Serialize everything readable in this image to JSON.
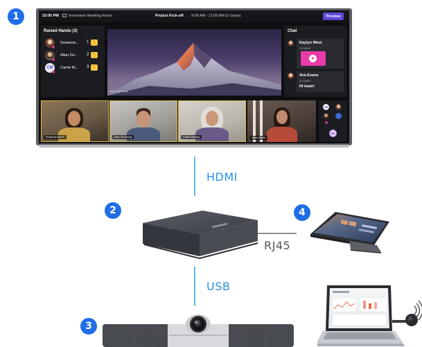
{
  "badges": {
    "display": "1",
    "hub": "2",
    "camera": "3",
    "touch_panel": "4"
  },
  "meeting": {
    "time": "10:00 PM",
    "room": "Immersive Meeting Room",
    "title": "Project Kick-off",
    "time_range": "9:00 AM - 11:00 AM (2 hours)",
    "preview_label": "Preview"
  },
  "raised_hands": {
    "title": "Raised Hands (3)",
    "people": [
      {
        "name": "Susanna...",
        "rank": "1",
        "initials": ""
      },
      {
        "name": "Allan De...",
        "rank": "2",
        "initials": ""
      },
      {
        "name": "Carrie M...",
        "rank": "3",
        "initials": "CM"
      }
    ]
  },
  "stage": {
    "speaker": "Allan DeYoung"
  },
  "chat": {
    "title": "Chat",
    "messages": [
      {
        "author": "Kaylyn West",
        "time": "10:08AM",
        "text": ""
      },
      {
        "author": "Ava Evans",
        "time": "10:08AM",
        "text": "Hi team!"
      }
    ]
  },
  "tiles": [
    {
      "caption": "Susanna Alberti"
    },
    {
      "caption": "Allan DeYoung"
    },
    {
      "caption": "Carrie Murphy"
    },
    {
      "caption": "Jena Glante"
    }
  ],
  "roster_initials": [
    "CM",
    "MK"
  ],
  "connections": {
    "hdmi": "HDMI",
    "rj45": "RJ45",
    "usb": "USB"
  },
  "colors": {
    "accent_blue": "#1f6ee8",
    "line_blue": "#5ab8e8",
    "connector_text_blue": "#2a8fe0",
    "rj45_text": "#555555",
    "preview_purple": "#5b4bd6"
  }
}
